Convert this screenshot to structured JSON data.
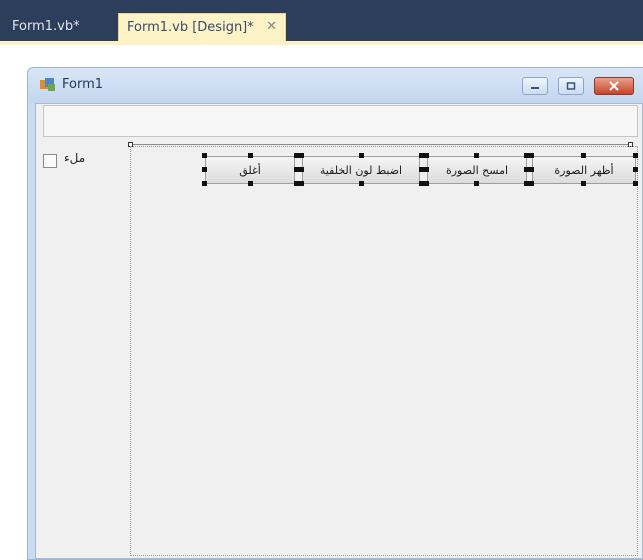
{
  "tabs": [
    {
      "label": "Form1.vb*",
      "active": false
    },
    {
      "label": "Form1.vb [Design]*",
      "active": true
    }
  ],
  "tab_close_glyph": "✕",
  "form": {
    "title": "Form1",
    "icon": "form-icon",
    "window_buttons": [
      "minimize-icon",
      "maximize-icon",
      "close-icon"
    ]
  },
  "checkbox": {
    "label": "ملء",
    "checked": false
  },
  "buttons": [
    {
      "label": "أظهر الصورة"
    },
    {
      "label": "امسح الصورة"
    },
    {
      "label": "اضبط لون الخلفية"
    },
    {
      "label": "أغلق"
    }
  ],
  "colors": {
    "tabstrip": "#2d3d5c",
    "active_tab": "#fdf3c7",
    "form_frame": "#c9dbf0",
    "client": "#f0f0f0"
  }
}
